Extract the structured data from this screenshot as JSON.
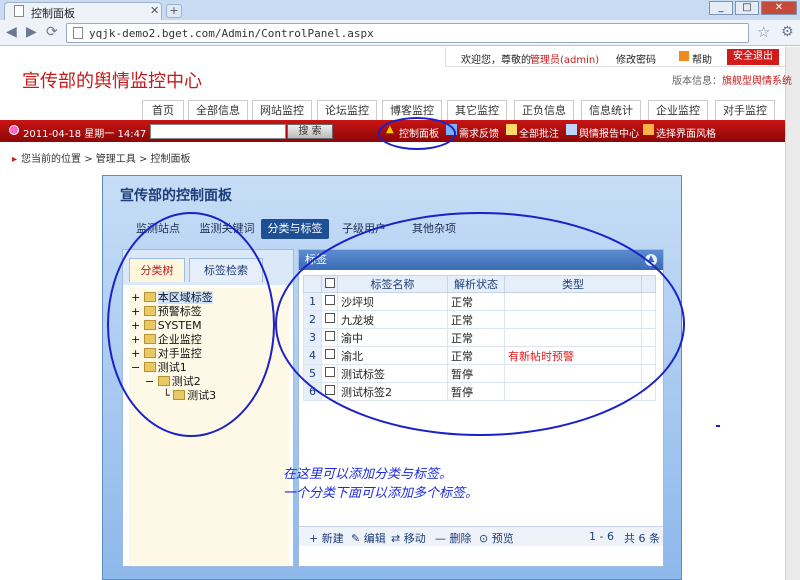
{
  "browser": {
    "tab_title": "控制面板",
    "url": "yqjk-demo2.bget.com/Admin/ControlPanel.aspx",
    "new_tab": "+",
    "min": "_",
    "max": "□",
    "close": "✕"
  },
  "header": {
    "welcome": "欢迎您，尊敬的",
    "username": "管理员(admin)",
    "change_password": "修改密码",
    "help": "帮助",
    "logout": "安全退出",
    "site_title": "宣传部的舆情监控中心",
    "version_label": "版本信息：",
    "version_value": "旗舰型舆情系统"
  },
  "nav": {
    "items": [
      "首页",
      "全部信息",
      "网站监控",
      "论坛监控",
      "博客监控",
      "其它监控",
      "正负信息",
      "信息统计",
      "企业监控",
      "对手监控"
    ]
  },
  "toolbar": {
    "date": "2011-04-18 星期一 14:47",
    "search_button": "搜 索",
    "links": [
      "控制面板",
      "需求反馈",
      "全部批注",
      "舆情报告中心",
      "选择界面风格"
    ]
  },
  "breadcrumb": "您当前的位置 > 管理工具 > 控制面板",
  "panel": {
    "title": "宣传部的控制面板",
    "tabs": [
      "监测站点",
      "监测关键词",
      "分类与标签",
      "子级用户",
      "其他杂项"
    ],
    "left_tabs": [
      "分类树",
      "标签检索"
    ],
    "tree": [
      "本区域标签",
      "预警标签",
      "SYSTEM",
      "企业监控",
      "对手监控",
      "测试1",
      "测试2",
      "测试3"
    ],
    "right_title": "标签",
    "columns": [
      "标签名称",
      "解析状态",
      "类型"
    ],
    "rows": [
      {
        "n": "1",
        "name": "沙坪坝",
        "status": "正常",
        "type": ""
      },
      {
        "n": "2",
        "name": "九龙坡",
        "status": "正常",
        "type": ""
      },
      {
        "n": "3",
        "name": "渝中",
        "status": "正常",
        "type": ""
      },
      {
        "n": "4",
        "name": "渝北",
        "status": "正常",
        "type": "有新帖时预警"
      },
      {
        "n": "5",
        "name": "测试标签",
        "status": "暂停",
        "type": ""
      },
      {
        "n": "6",
        "name": "测试标签2",
        "status": "暂停",
        "type": ""
      }
    ],
    "pager": {
      "new": "+ 新建",
      "edit": "✎ 编辑",
      "move": "⇄ 移动",
      "delete": "— 删除",
      "preview": "⊙ 预览",
      "range": "1 - 6",
      "total": "共 6 条"
    },
    "note_line1": "在这里可以添加分类与标签。",
    "note_line2": "一个分类下面可以添加多个标签。"
  },
  "colors": {
    "brand_red": "#c41a1a",
    "panel_blue": "#1d4f92",
    "annotation_blue": "#1a21c8"
  }
}
